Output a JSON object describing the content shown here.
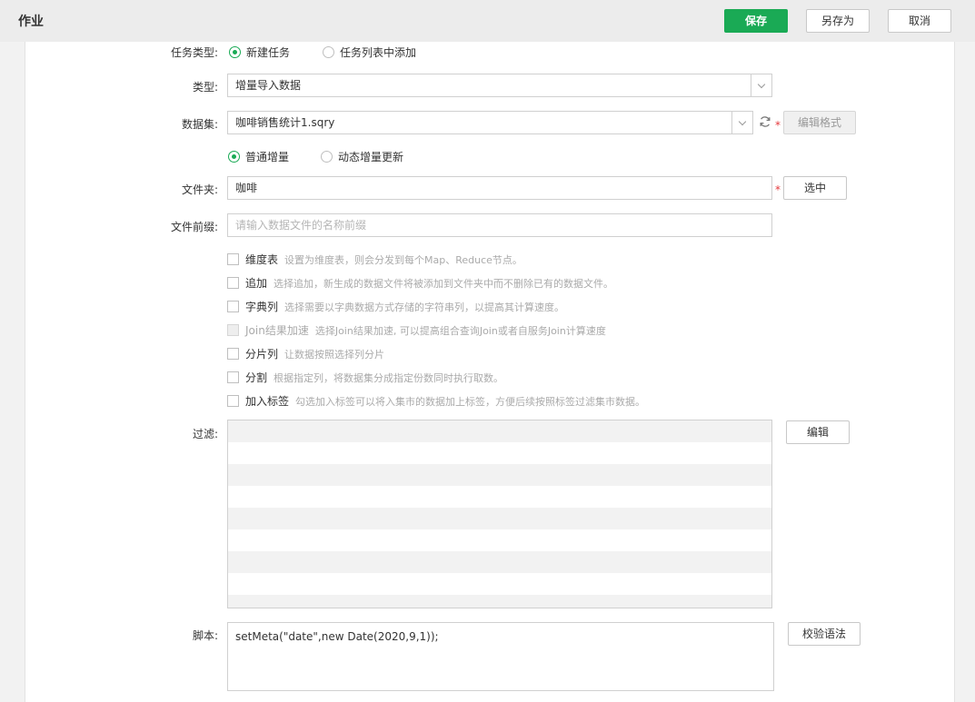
{
  "header": {
    "title": "作业",
    "save_label": "保存",
    "save_as_label": "另存为",
    "cancel_label": "取消"
  },
  "colors": {
    "accent": "#1aaa55",
    "required": "#e4393c"
  },
  "task_type": {
    "label": "任务类型:",
    "options": [
      {
        "label": "新建任务",
        "checked": true
      },
      {
        "label": "任务列表中添加",
        "checked": false
      }
    ]
  },
  "type": {
    "label": "类型:",
    "value": "增量导入数据"
  },
  "dataset": {
    "label": "数据集:",
    "value": "咖啡销售统计1.sqry",
    "refresh_icon": "refresh-icon",
    "required_mark": "*",
    "edit_format_label": "编辑格式"
  },
  "increment_mode": {
    "options": [
      {
        "label": "普通增量",
        "checked": true
      },
      {
        "label": "动态增量更新",
        "checked": false
      }
    ]
  },
  "folder": {
    "label": "文件夹:",
    "value": "咖啡",
    "required_mark": "*",
    "select_label": "选中"
  },
  "file_prefix": {
    "label": "文件前缀:",
    "placeholder": "请输入数据文件的名称前缀"
  },
  "options": [
    {
      "name": "维度表",
      "desc": "设置为维度表，则会分发到每个Map、Reduce节点。",
      "disabled": false
    },
    {
      "name": "追加",
      "desc": "选择追加，新生成的数据文件将被添加到文件夹中而不删除已有的数据文件。",
      "disabled": false
    },
    {
      "name": "字典列",
      "desc": "选择需要以字典数据方式存储的字符串列，以提高其计算速度。",
      "disabled": false
    },
    {
      "name": "Join结果加速",
      "desc": "选择Join结果加速, 可以提高组合查询Join或者自服务Join计算速度",
      "disabled": true
    },
    {
      "name": "分片列",
      "desc": "让数据按照选择列分片",
      "disabled": false
    },
    {
      "name": "分割",
      "desc": "根据指定列，将数据集分成指定份数同时执行取数。",
      "disabled": false
    },
    {
      "name": "加入标签",
      "desc": "勾选加入标签可以将入集市的数据加上标签，方便后续按照标签过滤集市数据。",
      "disabled": false
    }
  ],
  "filter": {
    "label": "过滤:",
    "edit_label": "编辑"
  },
  "script": {
    "label": "脚本:",
    "value": "setMeta(\"date\",new Date(2020,9,1));",
    "validate_label": "校验语法"
  }
}
